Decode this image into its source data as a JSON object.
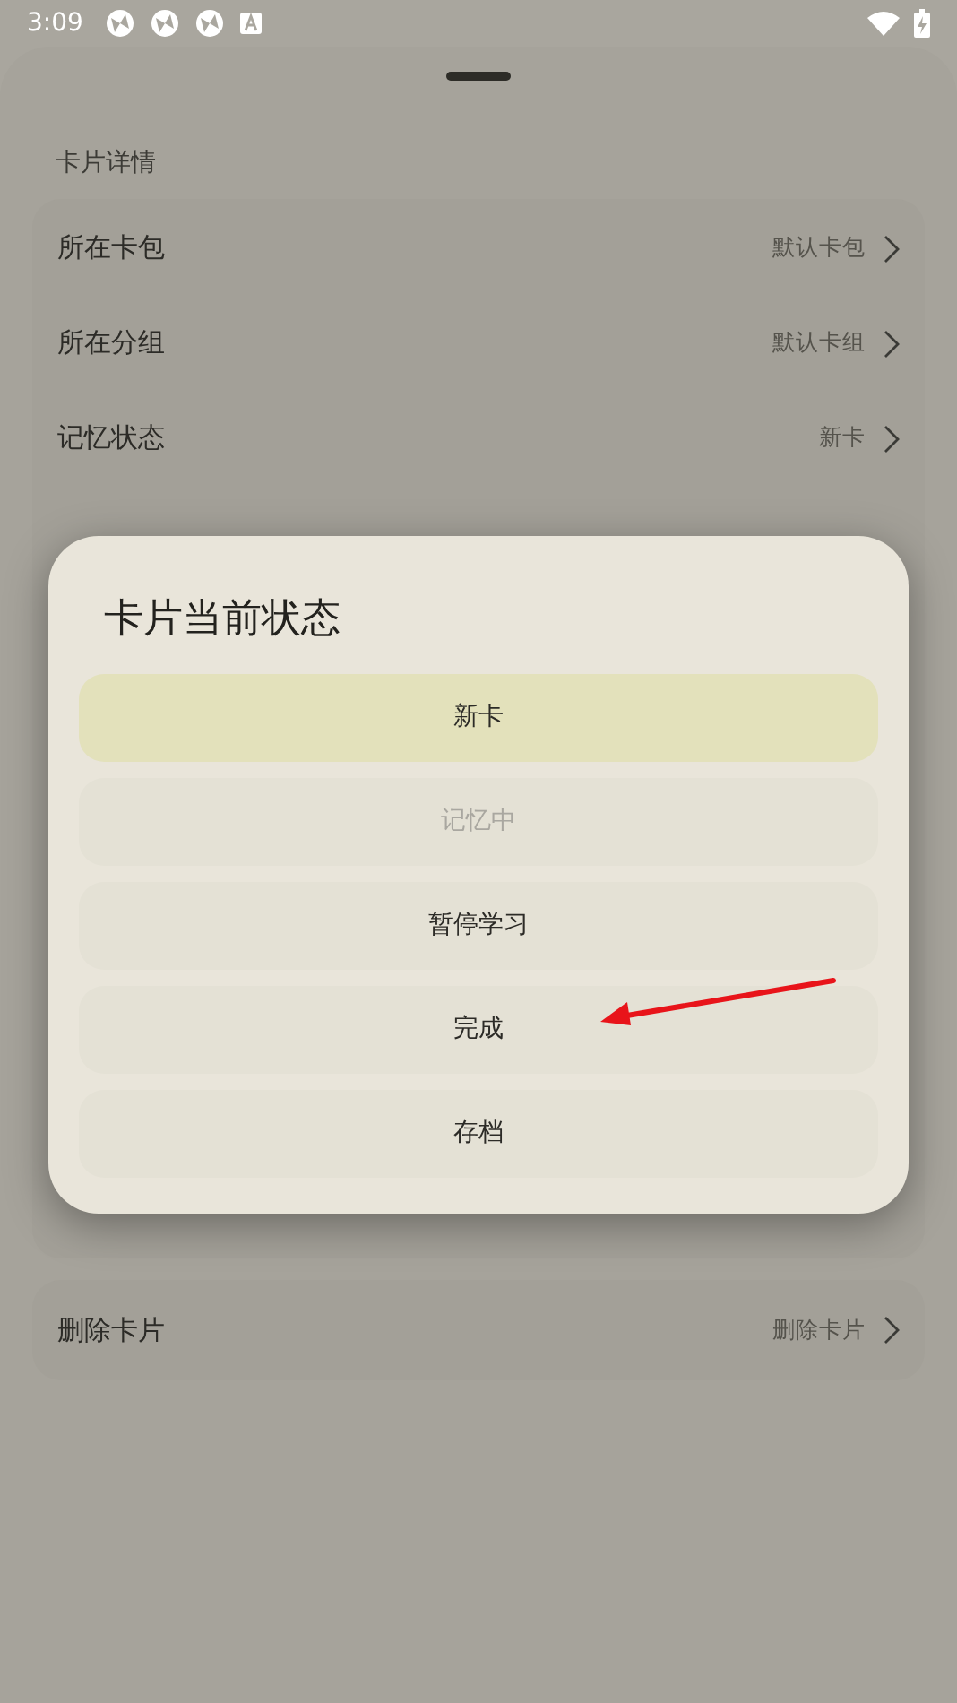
{
  "status_bar": {
    "time": "3:09"
  },
  "sheet": {
    "header": "卡片详情",
    "rows": [
      {
        "label": "所在卡包",
        "value": "默认卡包"
      },
      {
        "label": "所在分组",
        "value": "默认卡组"
      },
      {
        "label": "记忆状态",
        "value": "新卡"
      }
    ],
    "delete_row": {
      "label": "删除卡片",
      "value": "删除卡片"
    }
  },
  "dialog": {
    "title": "卡片当前状态",
    "options": [
      {
        "label": "新卡",
        "selected": true,
        "disabled": false
      },
      {
        "label": "记忆中",
        "selected": false,
        "disabled": true
      },
      {
        "label": "暂停学习",
        "selected": false,
        "disabled": false
      },
      {
        "label": "完成",
        "selected": false,
        "disabled": false
      },
      {
        "label": "存档",
        "selected": false,
        "disabled": false
      }
    ]
  }
}
